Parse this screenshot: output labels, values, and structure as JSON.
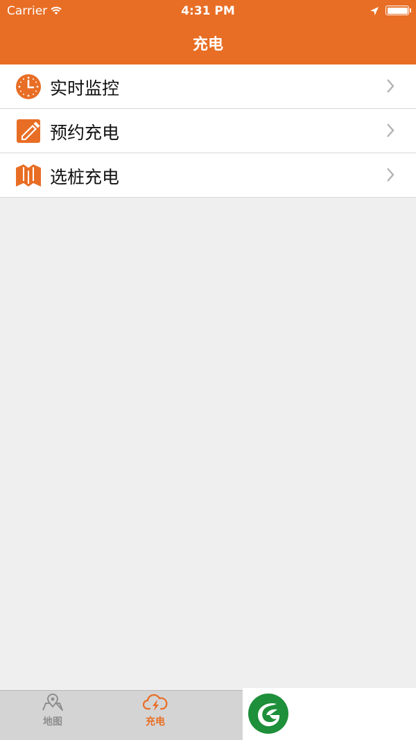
{
  "status_bar": {
    "carrier": "Carrier",
    "time": "4:31 PM"
  },
  "nav": {
    "title": "充电"
  },
  "menu": {
    "items": [
      {
        "label": "实时监控",
        "icon": "clock-icon"
      },
      {
        "label": "预约充电",
        "icon": "pencil-icon"
      },
      {
        "label": "选桩充电",
        "icon": "map-icon"
      }
    ]
  },
  "tabs": [
    {
      "label": "地图",
      "icon": "map-pin-icon",
      "selected": false
    },
    {
      "label": "充电",
      "icon": "cloud-lightning-icon",
      "selected": true
    }
  ],
  "colors": {
    "accent": "#e86e25",
    "background": "#efefef",
    "logo_green": "#1e8f3a"
  }
}
